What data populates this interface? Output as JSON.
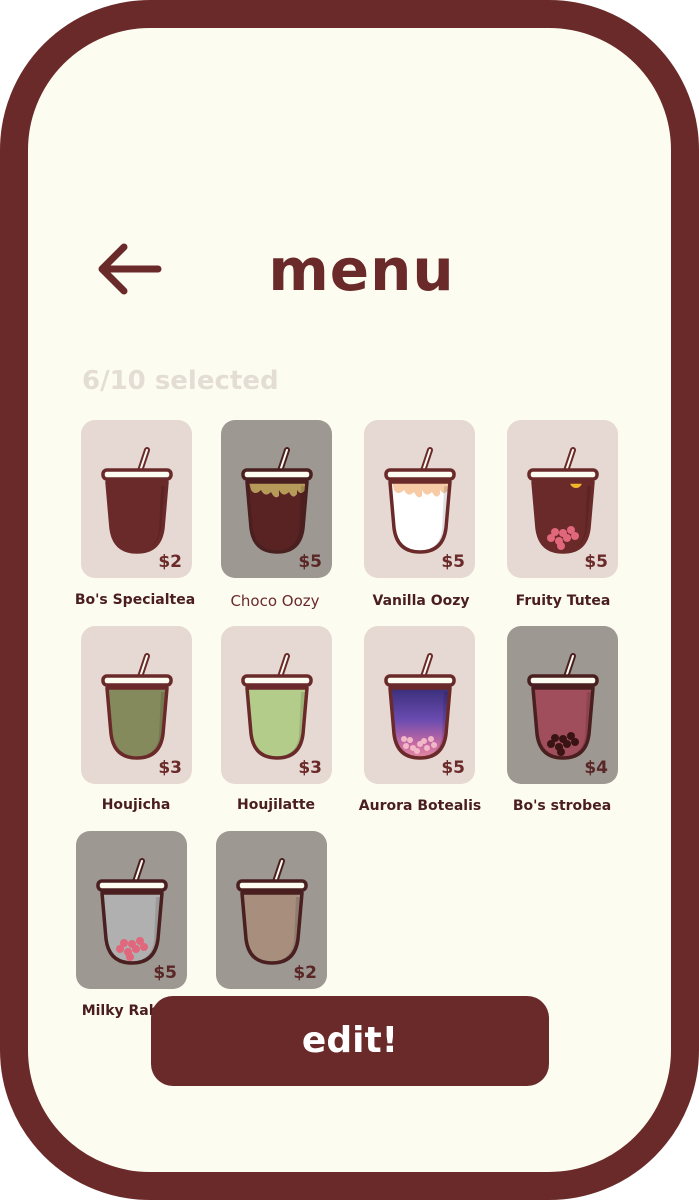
{
  "header": {
    "title": "menu",
    "back_icon": "arrow-left-icon"
  },
  "selection": {
    "text": "6/10 selected"
  },
  "colors": {
    "brand": "#6b2a2a",
    "background": "#fdfcf1",
    "card": "#e6d9d3",
    "card_dimmed": "#9e9893"
  },
  "menu_items": [
    {
      "name": "Bo's Specialtea",
      "price": "$2",
      "selected": true,
      "fill": "#6b2a2a",
      "topping": "none",
      "pearls": "none"
    },
    {
      "name": "Choco Oozy",
      "price": "$5",
      "selected": false,
      "fill": "#5a2323",
      "topping": "drip-gold",
      "pearls": "none"
    },
    {
      "name": "Vanilla Oozy",
      "price": "$5",
      "selected": true,
      "fill": "#ffffff",
      "topping": "drip-peach",
      "pearls": "none"
    },
    {
      "name": "Fruity Tutea",
      "price": "$5",
      "selected": true,
      "fill": "#6b2a2a",
      "topping": "orange-slice",
      "pearls": "pink"
    },
    {
      "name": "Houjicha",
      "price": "$3",
      "selected": true,
      "fill": "#858a5c",
      "topping": "none",
      "pearls": "none"
    },
    {
      "name": "Houjilatte",
      "price": "$3",
      "selected": true,
      "fill": "#b3cc8a",
      "topping": "none",
      "pearls": "none"
    },
    {
      "name": "Aurora Botealis",
      "price": "$5",
      "selected": true,
      "fill": "gradient",
      "topping": "none",
      "pearls": "pink-small"
    },
    {
      "name": "Bo's strobea",
      "price": "$4",
      "selected": false,
      "fill": "#a14e5c",
      "topping": "none",
      "pearls": "dark"
    },
    {
      "name": "Milky Rabbit",
      "price": "$5",
      "selected": false,
      "fill": "#b0b0b0",
      "topping": "none",
      "pearls": "pink"
    },
    {
      "name": "",
      "price": "$2",
      "selected": false,
      "fill": "#a78e7d",
      "topping": "none",
      "pearls": "none"
    }
  ],
  "actions": {
    "edit_label": "edit!"
  }
}
